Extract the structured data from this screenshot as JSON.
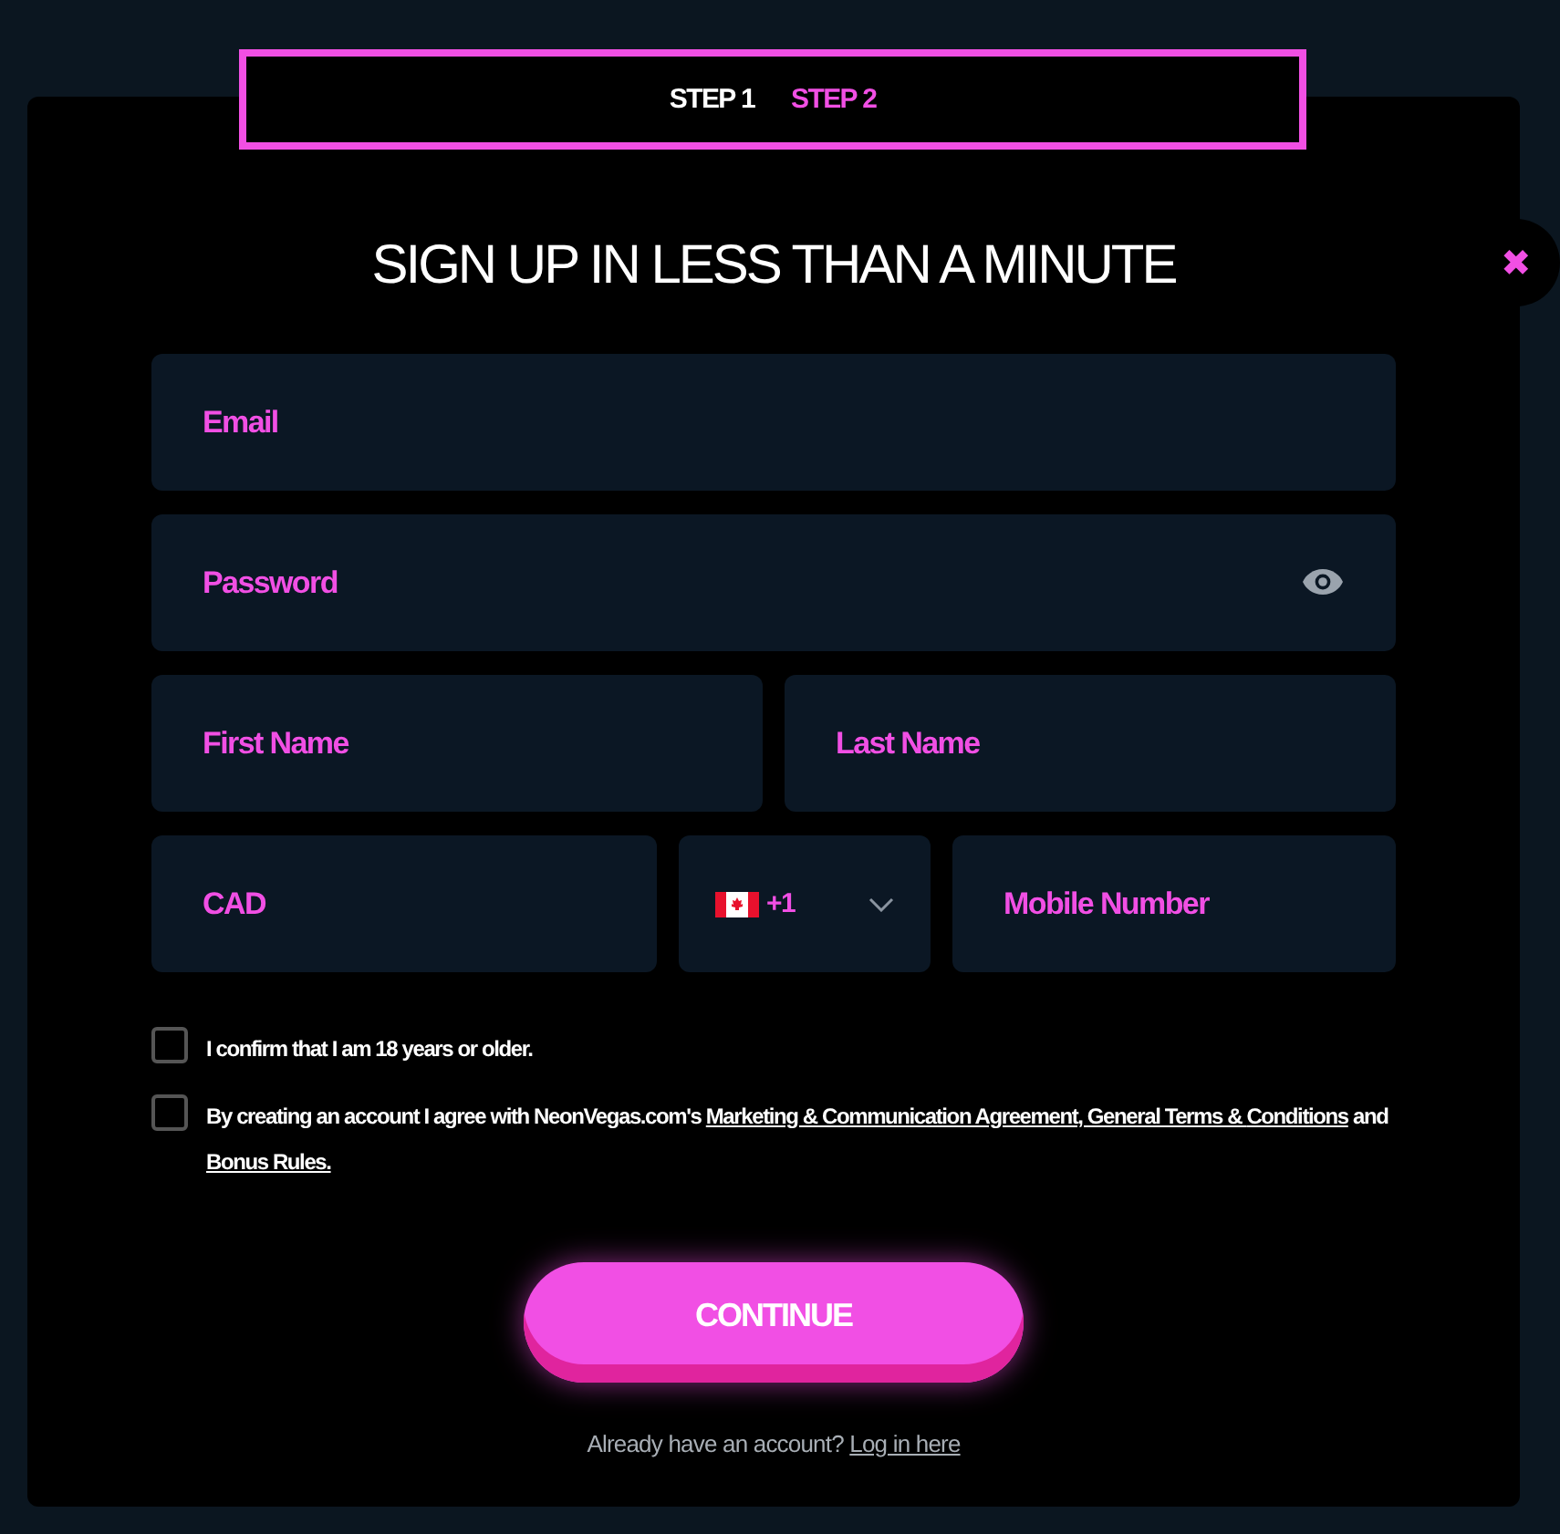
{
  "steps": [
    {
      "label": "STEP 1",
      "selected": false
    },
    {
      "label": "STEP 2",
      "selected": true
    }
  ],
  "close": {
    "icon": "✖"
  },
  "title": "SIGN UP IN LESS THAN A MINUTE",
  "email": {
    "placeholder": "Email"
  },
  "password": {
    "placeholder": "Password"
  },
  "first_name": {
    "placeholder": "First Name"
  },
  "last_name": {
    "placeholder": "Last Name"
  },
  "currency": {
    "value": "CAD"
  },
  "phone_code": {
    "value": "+1"
  },
  "mobile": {
    "placeholder": "Mobile Number"
  },
  "consents": [
    {
      "checked": false,
      "parts": [
        {
          "text": "I confirm that I am 18 years or older.",
          "link": false
        }
      ]
    },
    {
      "checked": false,
      "parts": [
        {
          "text": "By creating an account I agree with NeonVegas.com's ",
          "link": false
        },
        {
          "text": "Marketing & Communication Agreement, General Terms & ",
          "link": true
        },
        {
          "text": "Conditions",
          "link": true
        },
        {
          "text": " and ",
          "link": false
        },
        {
          "text": "Bonus Rules.",
          "link": true
        }
      ]
    }
  ],
  "continue_button": "CONTINUE",
  "login": {
    "text": "Already have an account?",
    "link": "Log in here"
  }
}
